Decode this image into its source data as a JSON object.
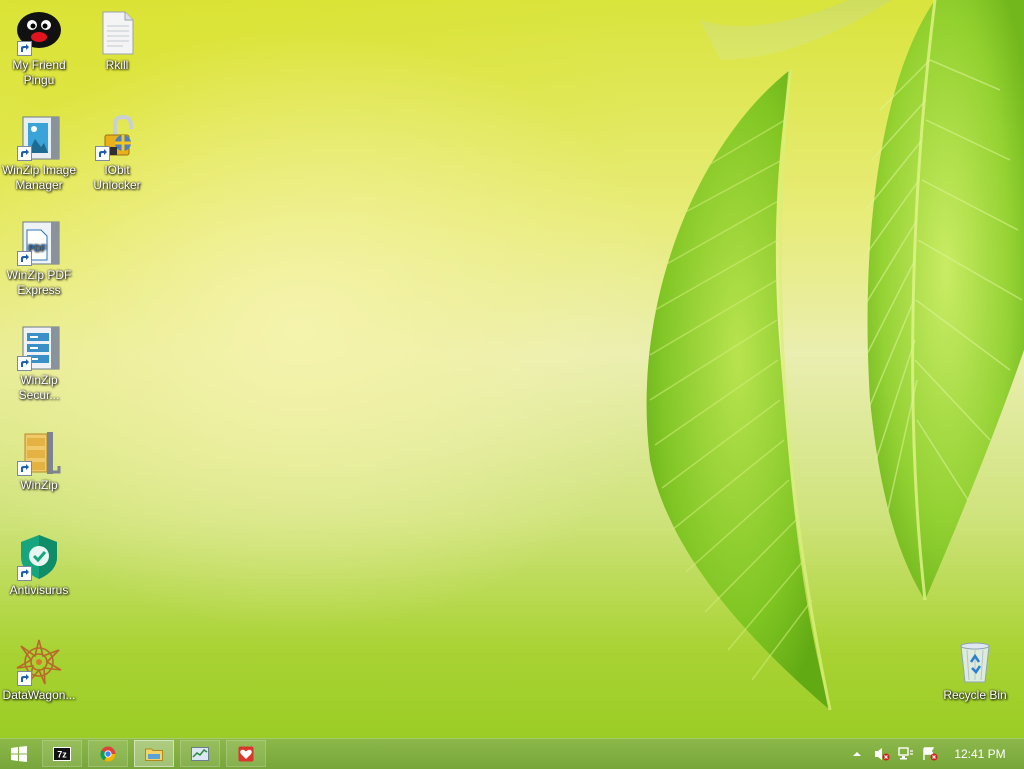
{
  "desktop": {
    "icons": [
      {
        "id": "pingu",
        "label": "My Friend Pingu",
        "icon": "pingu-icon"
      },
      {
        "id": "rkill",
        "label": "Rkill",
        "icon": "document-icon"
      },
      {
        "id": "winzip-image",
        "label": "WinZip Image Manager",
        "icon": "winzip-image-manager-icon"
      },
      {
        "id": "iobit",
        "label": "IObit Unlocker",
        "icon": "iobit-unlocker-icon"
      },
      {
        "id": "winzip-pdf",
        "label": "WinZip PDF Express",
        "icon": "pdf-icon"
      },
      {
        "id": "winzip-secure",
        "label": "WinZip Secur...",
        "icon": "winzip-secure-icon"
      },
      {
        "id": "winzip",
        "label": "WinZip",
        "icon": "winzip-icon"
      },
      {
        "id": "antivisurus",
        "label": "Antivisurus",
        "icon": "shield-icon"
      },
      {
        "id": "datawagon",
        "label": "DataWagon...",
        "icon": "datawagon-icon"
      },
      {
        "id": "recycle-bin",
        "label": "Recycle Bin",
        "icon": "recycle-bin-icon"
      }
    ]
  },
  "taskbar": {
    "start": "windows-logo-icon",
    "pinned": [
      {
        "icon": "7zip-icon",
        "glyph": "7z"
      },
      {
        "icon": "chrome-icon"
      },
      {
        "icon": "file-explorer-icon"
      },
      {
        "icon": "task-manager-icon"
      },
      {
        "icon": "heart-app-icon"
      }
    ],
    "tray": [
      "show-hidden-icons",
      "speaker-muted-icon",
      "network-icon",
      "action-center-icon"
    ],
    "clock": "12:41 PM"
  }
}
